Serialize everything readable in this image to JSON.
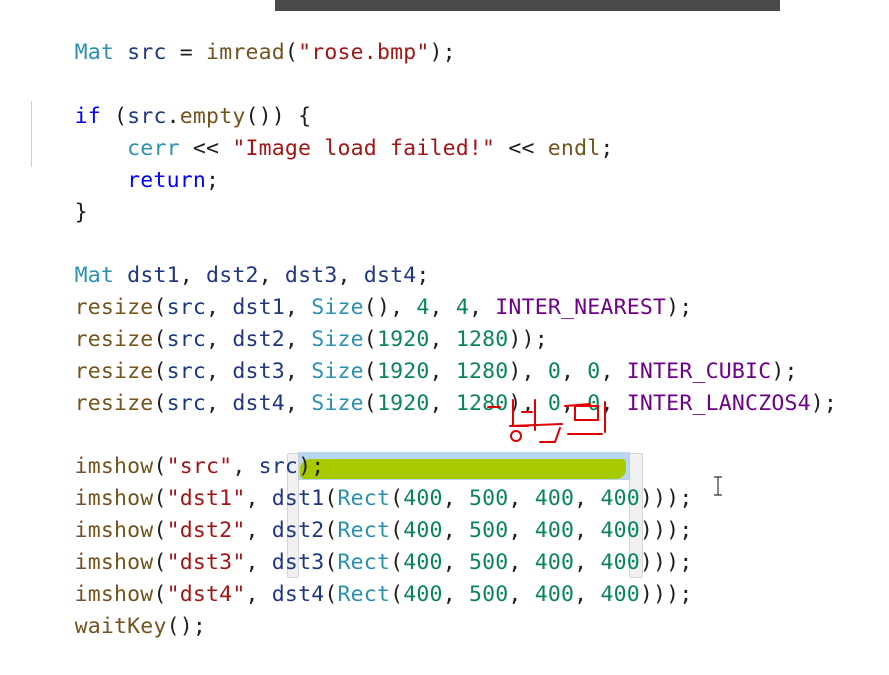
{
  "code_lines": [
    "Mat src = imread(\"rose.bmp\");",
    "",
    "if (src.empty()) {",
    "    cerr << \"Image load failed!\" << endl;",
    "    return;",
    "}",
    "",
    "Mat dst1, dst2, dst3, dst4;",
    "resize(src, dst1, Size(), 4, 4, INTER_NEAREST);",
    "resize(src, dst2, Size(1920, 1280));",
    "resize(src, dst3, Size(1920, 1280), 0, 0, INTER_CUBIC);",
    "resize(src, dst4, Size(1920, 1280), 0, 0, INTER_LANCZOS4);",
    "",
    "imshow(\"src\", src);",
    "imshow(\"dst1\", dst1(Rect(400, 500, 400, 400)));",
    "imshow(\"dst2\", dst2(Rect(400, 500, 400, 400)));",
    "imshow(\"dst3\", dst3(Rect(400, 500, 400, 400)));",
    "imshow(\"dst4\", dst4(Rect(400, 500, 400, 400)));",
    "waitKey();"
  ],
  "colors": {
    "keyword": "#0000ff",
    "type": "#2b91af",
    "string": "#a31515",
    "function": "#74531f",
    "number": "#098658",
    "macro": "#6f008a",
    "selection_highlight": "#b9d6f0",
    "marker_highlight": "#a7c900",
    "annotation_ink": "#e00000"
  },
  "icons": {
    "mouse_cursor": "text-ibeam-cursor-icon",
    "handwritten_note": "handwritten-korean-annotation-icon"
  }
}
